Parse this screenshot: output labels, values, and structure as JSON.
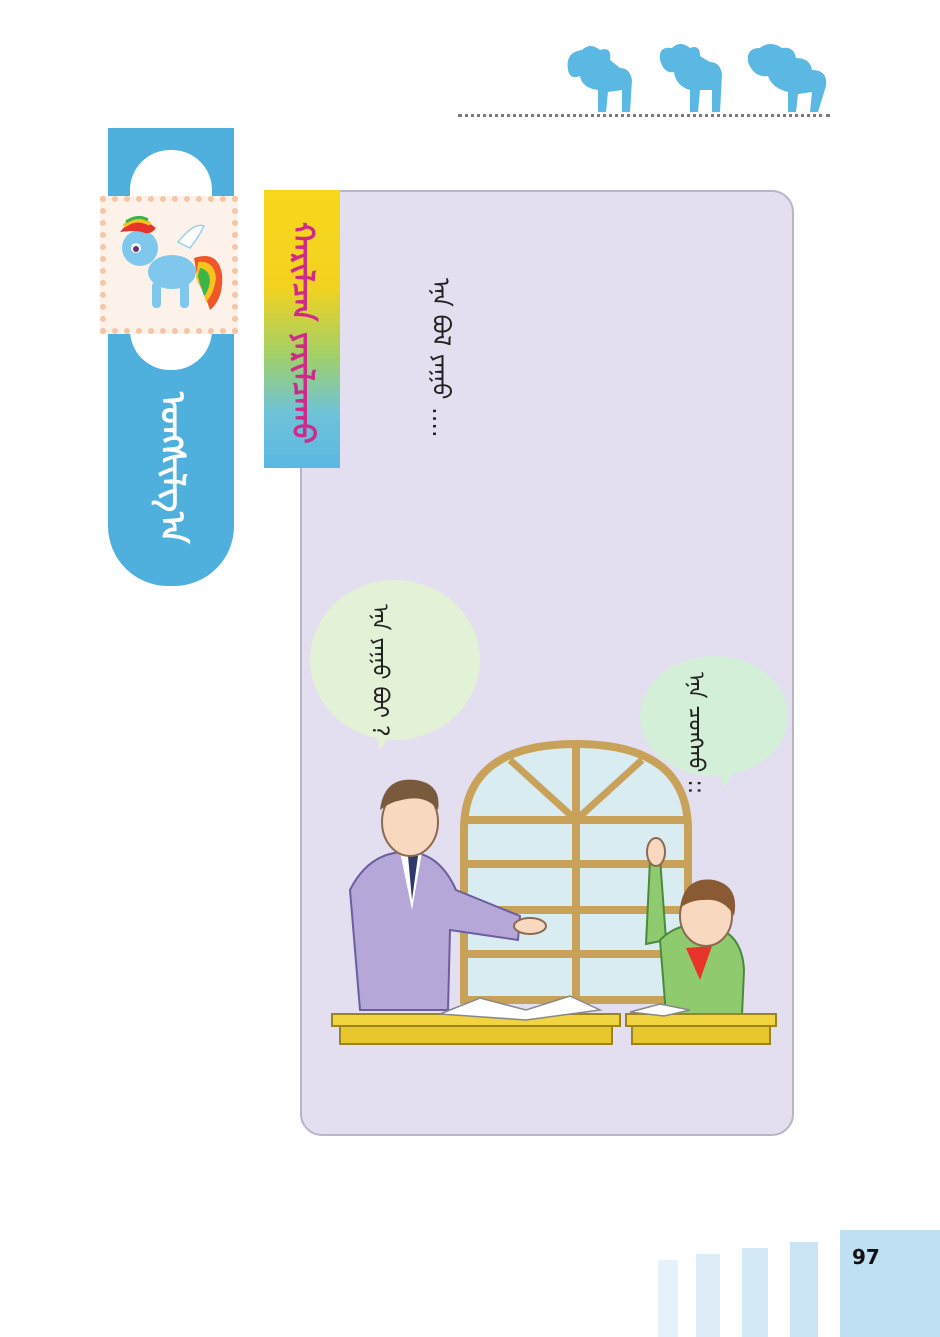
{
  "header": {
    "ponies_colors": [
      "#5ab8e2",
      "#5ab8e2",
      "#5ab8e2"
    ]
  },
  "side_tab": {
    "title": "ᠤᠩᠰᠢᠯᠭ᠎ᠠ",
    "color": "#4fb0de"
  },
  "ribbon": {
    "title": "ᠬᠠᠷᠢᠯᠴᠠᠨ ᠶᠠᠷᠢᠯᠴᠠᠬᠤ"
  },
  "card": {
    "intro": "ᠡᠨᠡ ᠪᠣᠯ ᠶᠠᠭᠤ ....",
    "bubble_left": "ᠡᠨᠡ ᠶᠠᠭᠤ ᠪᠤᠢ ?",
    "bubble_right": "ᠡᠨᠡ ᠴᠣᠩᠬᠣ ::",
    "background": "#e3def0"
  },
  "footer": {
    "page_number": "97"
  }
}
